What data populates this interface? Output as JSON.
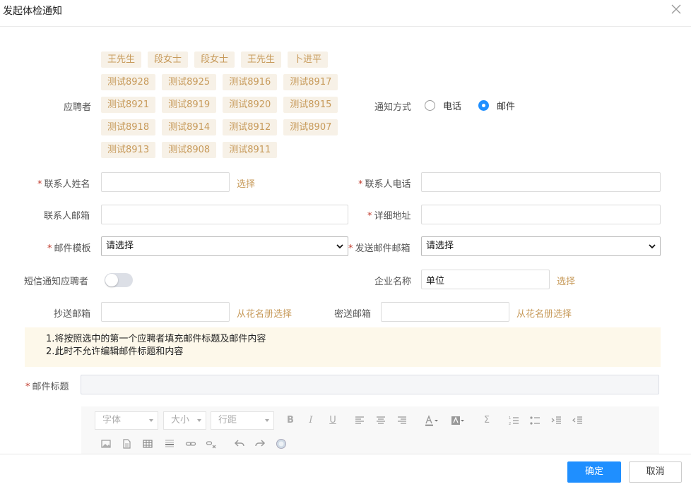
{
  "dialog": {
    "title": "发起体检通知"
  },
  "applicants": {
    "label": "应聘者",
    "rows": [
      [
        "王先生",
        "段女士",
        "段女士",
        "王先生",
        "卜进平"
      ],
      [
        "测试8928",
        "测试8925",
        "测试8916",
        "测试8917"
      ],
      [
        "测试8921",
        "测试8919",
        "测试8920",
        "测试8915"
      ],
      [
        "测试8918",
        "测试8914",
        "测试8912",
        "测试8907"
      ],
      [
        "测试8913",
        "测试8908",
        "测试8911"
      ]
    ]
  },
  "notify_method": {
    "label": "通知方式",
    "options": [
      "电话",
      "邮件"
    ],
    "selected": "邮件"
  },
  "form": {
    "contact_name": {
      "label": "联系人姓名",
      "value": "",
      "select_link": "选择"
    },
    "contact_phone": {
      "label": "联系人电话",
      "value": ""
    },
    "contact_email": {
      "label": "联系人邮箱",
      "value": ""
    },
    "address": {
      "label": "详细地址",
      "value": ""
    },
    "mail_template": {
      "label": "邮件模板",
      "value": "请选择"
    },
    "sender_mailbox": {
      "label": "发送邮件邮箱",
      "value": "请选择"
    },
    "sms_notify": {
      "label": "短信通知应聘者",
      "on": false
    },
    "company_name": {
      "label": "企业名称",
      "value": "单位",
      "select_link": "选择"
    },
    "cc_email": {
      "label": "抄送邮箱",
      "value": "",
      "roster_link": "从花名册选择"
    },
    "bcc_email": {
      "label": "密送邮箱",
      "value": "",
      "roster_link": "从花名册选择"
    },
    "mail_subject": {
      "label": "邮件标题",
      "value": ""
    }
  },
  "notice": {
    "line1": "1.将按照选中的第一个应聘者填充邮件标题及邮件内容",
    "line2": "2.此时不允许编辑邮件标题和内容"
  },
  "editor": {
    "font": "字体",
    "size": "大小",
    "line_height": "行距"
  },
  "footer": {
    "ok": "确定",
    "cancel": "取消"
  },
  "colors": {
    "accent": "#1f8fff",
    "tag_bg": "#f7f1e7",
    "tag_text": "#c79a5a",
    "required": "#c0392b",
    "notice_bg": "#fdf8ea"
  }
}
